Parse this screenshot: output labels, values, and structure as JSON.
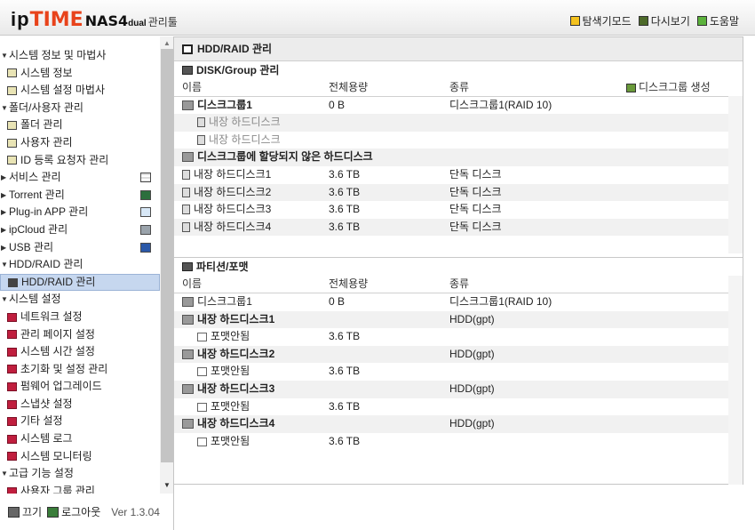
{
  "header": {
    "logo_ip": "ip",
    "logo_time": "TIME",
    "logo_model": "NAS4",
    "logo_sub": "dual",
    "logo_mgr": "관리툴",
    "menu": [
      {
        "label": "탐색기모드",
        "icon": "explorer-mode-icon"
      },
      {
        "label": "다시보기",
        "icon": "refresh-icon"
      },
      {
        "label": "도움말",
        "icon": "help-icon"
      }
    ]
  },
  "sidebar": {
    "items": [
      {
        "label": "시스템 정보 및 마법사",
        "level": 0,
        "arrow": "▼"
      },
      {
        "label": "시스템 정보",
        "level": 1,
        "icon": "sys"
      },
      {
        "label": "시스템 설정 마법사",
        "level": 1,
        "icon": "sys"
      },
      {
        "label": "폴더/사용자 관리",
        "level": 0,
        "arrow": "▼"
      },
      {
        "label": "폴더 관리",
        "level": 1,
        "icon": "sys"
      },
      {
        "label": "사용자 관리",
        "level": 1,
        "icon": "sys"
      },
      {
        "label": "ID 등록 요청자 관리",
        "level": 1,
        "icon": "sys"
      },
      {
        "label": "서비스 관리",
        "level": 0,
        "arrow": "▶",
        "side": "s-svc"
      },
      {
        "label": "Torrent 관리",
        "level": 0,
        "arrow": "▶",
        "side": "s-tor"
      },
      {
        "label": "Plug-in APP 관리",
        "level": 0,
        "arrow": "▶",
        "side": "s-plug"
      },
      {
        "label": "ipCloud 관리",
        "level": 0,
        "arrow": "▶",
        "side": "s-cloud"
      },
      {
        "label": "USB 관리",
        "level": 0,
        "arrow": "▶",
        "side": "s-usb"
      },
      {
        "label": "HDD/RAID 관리",
        "level": 0,
        "arrow": "▼"
      },
      {
        "label": "HDD/RAID 관리",
        "level": 1,
        "icon": "hdd",
        "selected": true
      },
      {
        "label": "시스템 설정",
        "level": 0,
        "arrow": "▼"
      },
      {
        "label": "네트워크 설정",
        "level": 1,
        "icon": "red"
      },
      {
        "label": "관리 페이지 설정",
        "level": 1,
        "icon": "red"
      },
      {
        "label": "시스템 시간 설정",
        "level": 1,
        "icon": "red"
      },
      {
        "label": "초기화 및 설정 관리",
        "level": 1,
        "icon": "red"
      },
      {
        "label": "펌웨어 업그레이드",
        "level": 1,
        "icon": "red"
      },
      {
        "label": "스냅샷 설정",
        "level": 1,
        "icon": "red"
      },
      {
        "label": "기타 설정",
        "level": 1,
        "icon": "red"
      },
      {
        "label": "시스템 로그",
        "level": 1,
        "icon": "red"
      },
      {
        "label": "시스템 모니터링",
        "level": 1,
        "icon": "red"
      },
      {
        "label": "고급 기능 설정",
        "level": 0,
        "arrow": "▼"
      },
      {
        "label": "사용자 그룹 관리",
        "level": 1,
        "icon": "red"
      }
    ],
    "footer": {
      "power": "끄기",
      "logout": "로그아웃",
      "version": "Ver 1.3.04"
    }
  },
  "main": {
    "title": "HDD/RAID 관리",
    "disk_section": {
      "title": "DISK/Group 관리",
      "columns": [
        "이름",
        "전체용량",
        "종류"
      ],
      "create_label": "디스크그룹 생성",
      "rows": [
        {
          "name": "디스크그룹1",
          "capacity": "0 B",
          "type": "디스크그룹1(RAID 10)",
          "style": "group"
        },
        {
          "name": "내장 하드디스크",
          "capacity": "",
          "type": "",
          "style": "member"
        },
        {
          "name": "내장 하드디스크",
          "capacity": "",
          "type": "",
          "style": "member"
        },
        {
          "name": "디스크그룹에 할당되지 않은 하드디스크",
          "capacity": "",
          "type": "",
          "style": "group"
        },
        {
          "name": "내장 하드디스크1",
          "capacity": "3.6 TB",
          "type": "단독 디스크",
          "style": "disk"
        },
        {
          "name": "내장 하드디스크2",
          "capacity": "3.6 TB",
          "type": "단독 디스크",
          "style": "disk"
        },
        {
          "name": "내장 하드디스크3",
          "capacity": "3.6 TB",
          "type": "단독 디스크",
          "style": "disk"
        },
        {
          "name": "내장 하드디스크4",
          "capacity": "3.6 TB",
          "type": "단독 디스크",
          "style": "disk"
        }
      ]
    },
    "partition_section": {
      "title": "파티션/포맷",
      "columns": [
        "이름",
        "전체용량",
        "종류"
      ],
      "rows": [
        {
          "name": "디스크그룹1",
          "capacity": "0 B",
          "type": "디스크그룹1(RAID 10)",
          "style": "plain"
        },
        {
          "name": "내장 하드디스크1",
          "capacity": "",
          "type": "HDD(gpt)",
          "style": "bold"
        },
        {
          "name": "포맷안됨",
          "capacity": "3.6 TB",
          "type": "",
          "style": "fmt"
        },
        {
          "name": "내장 하드디스크2",
          "capacity": "",
          "type": "HDD(gpt)",
          "style": "bold"
        },
        {
          "name": "포맷안됨",
          "capacity": "3.6 TB",
          "type": "",
          "style": "fmt"
        },
        {
          "name": "내장 하드디스크3",
          "capacity": "",
          "type": "HDD(gpt)",
          "style": "bold"
        },
        {
          "name": "포맷안됨",
          "capacity": "3.6 TB",
          "type": "",
          "style": "fmt"
        },
        {
          "name": "내장 하드디스크4",
          "capacity": "",
          "type": "HDD(gpt)",
          "style": "bold"
        },
        {
          "name": "포맷안됨",
          "capacity": "3.6 TB",
          "type": "",
          "style": "fmt"
        }
      ]
    }
  }
}
